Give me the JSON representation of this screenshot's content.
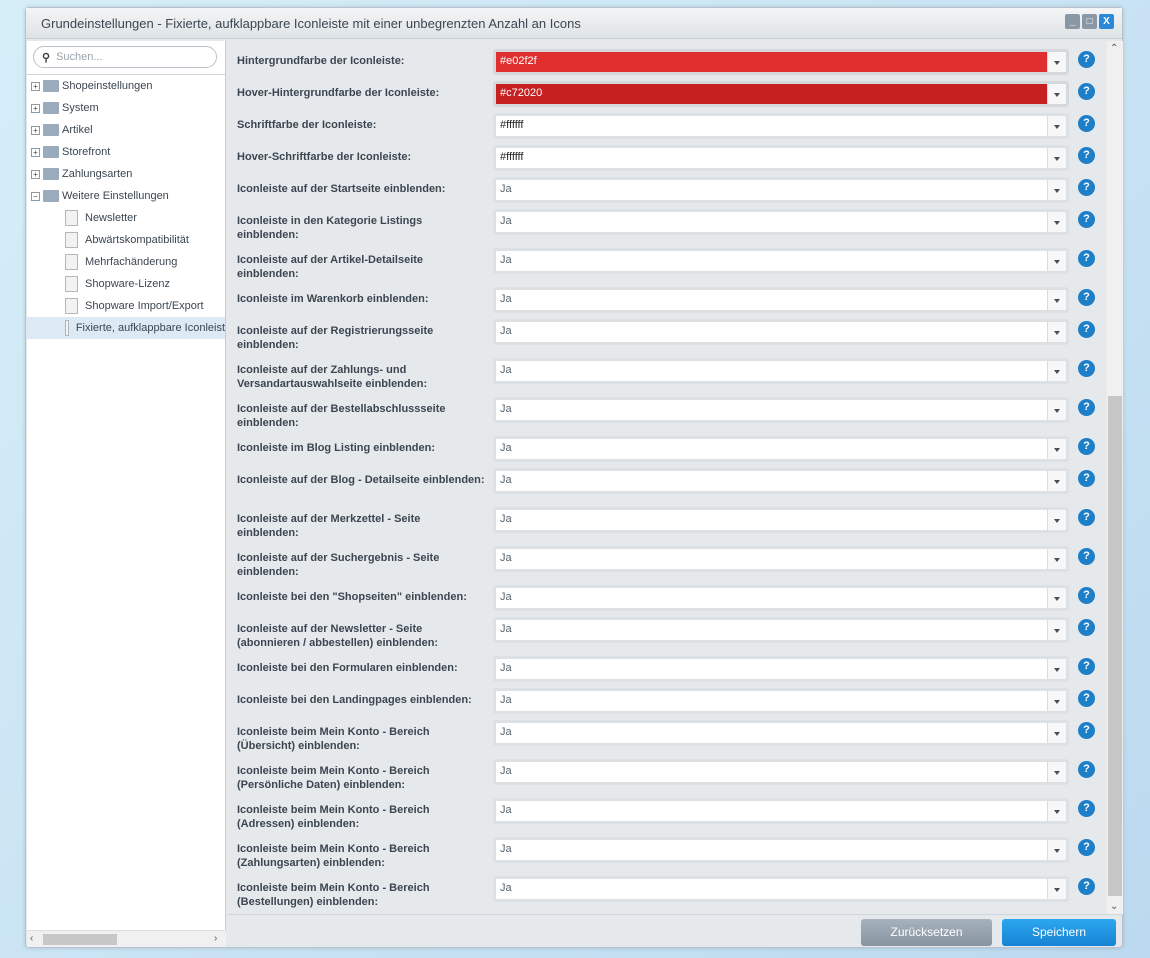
{
  "window": {
    "title": "Grundeinstellungen - Fixierte, aufklappbare Iconleiste mit einer unbegrenzten Anzahl an Icons"
  },
  "sidebar": {
    "search_placeholder": "Suchen...",
    "folders": [
      "Shopeinstellungen",
      "System",
      "Artikel",
      "Storefront",
      "Zahlungsarten"
    ],
    "expanded": "Weitere Einstellungen",
    "children": [
      "Newsletter",
      "Abwärtskompatibilität",
      "Mehrfachänderung",
      "Shopware-Lizenz",
      "Shopware Import/Export",
      "Fixierte, aufklappbare Iconleist"
    ]
  },
  "colors": {
    "bg": "#e02f2f",
    "hover": "#c72020",
    "accent": "#1e7fc9"
  },
  "fields": [
    {
      "label": "Hintergrundfarbe der Iconleiste:",
      "value": "#e02f2f",
      "color": "#e02f2f"
    },
    {
      "label": "Hover-Hintergrundfarbe der Iconleiste:",
      "value": "#c72020",
      "color": "#c72020"
    },
    {
      "label": "Schriftfarbe der Iconleiste:",
      "value": "#ffffff"
    },
    {
      "label": "Hover-Schriftfarbe der Iconleiste:",
      "value": "#ffffff"
    },
    {
      "label": "Iconleiste auf der Startseite einblenden:",
      "value": "Ja"
    },
    {
      "label": "Iconleiste in den Kategorie Listings einblenden:",
      "value": "Ja",
      "two": true
    },
    {
      "label": "Iconleiste auf der Artikel-Detailseite einblenden:",
      "value": "Ja",
      "two": true
    },
    {
      "label": "Iconleiste im Warenkorb einblenden:",
      "value": "Ja"
    },
    {
      "label": "Iconleiste auf der Registrierungsseite einblenden:",
      "value": "Ja",
      "two": true
    },
    {
      "label": "Iconleiste auf der Zahlungs- und Versandartauswahlseite einblenden:",
      "value": "Ja",
      "two": true
    },
    {
      "label": "Iconleiste auf der Bestellabschlussseite einblenden:",
      "value": "Ja",
      "two": true
    },
    {
      "label": "Iconleiste im Blog Listing einblenden:",
      "value": "Ja"
    },
    {
      "label": "Iconleiste auf der Blog - Detailseite einblenden:",
      "value": "Ja",
      "two": true
    },
    {
      "label": "Iconleiste auf der Merkzettel - Seite einblenden:",
      "value": "Ja",
      "two": true
    },
    {
      "label": "Iconleiste auf der Suchergebnis - Seite einblenden:",
      "value": "Ja",
      "two": true
    },
    {
      "label": "Iconleiste bei den \"Shopseiten\" einblenden:",
      "value": "Ja"
    },
    {
      "label": "Iconleiste auf der Newsletter - Seite (abonnieren / abbestellen) einblenden:",
      "value": "Ja",
      "two": true
    },
    {
      "label": "Iconleiste bei den Formularen einblenden:",
      "value": "Ja"
    },
    {
      "label": "Iconleiste bei den Landingpages einblenden:",
      "value": "Ja"
    },
    {
      "label": "Iconleiste beim Mein Konto - Bereich (Übersicht) einblenden:",
      "value": "Ja",
      "two": true
    },
    {
      "label": "Iconleiste beim Mein Konto - Bereich (Persönliche Daten) einblenden:",
      "value": "Ja",
      "two": true
    },
    {
      "label": "Iconleiste beim Mein Konto - Bereich (Adressen) einblenden:",
      "value": "Ja",
      "two": true
    },
    {
      "label": "Iconleiste beim Mein Konto - Bereich (Zahlungsarten) einblenden:",
      "value": "Ja",
      "two": true
    },
    {
      "label": "Iconleiste beim Mein Konto - Bereich (Bestellungen) einblenden:",
      "value": "Ja",
      "two": true
    }
  ],
  "footer": {
    "reset": "Zurücksetzen",
    "save": "Speichern"
  }
}
